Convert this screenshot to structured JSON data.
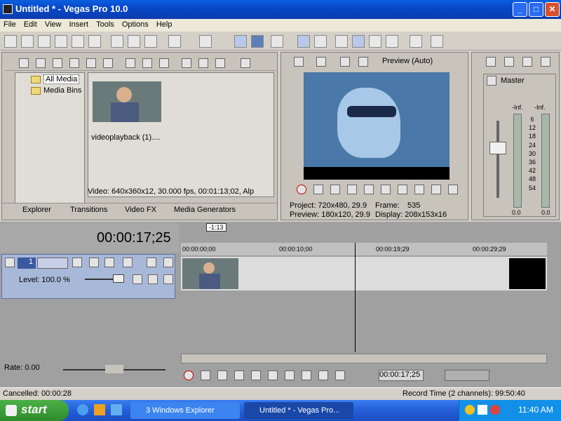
{
  "window": {
    "title": "Untitled * - Vegas Pro 10.0",
    "buttons": [
      "_",
      "□",
      "✕"
    ]
  },
  "menu": [
    "File",
    "Edit",
    "View",
    "Insert",
    "Tools",
    "Options",
    "Help"
  ],
  "explorer": {
    "tree": [
      "All Media",
      "Media Bins"
    ],
    "media_item": "videoplayback (1)....",
    "info": "Video: 640x360x12, 30.000 fps, 00:01:13;02, Alp",
    "tabs": [
      "Explorer",
      "Transitions",
      "Video FX",
      "Media Generators"
    ]
  },
  "preview": {
    "mode": "Preview (Auto)",
    "project": "Project:  720x480, 29.9",
    "preview_line": "Preview: 180x120, 29.9",
    "frame_label": "Frame:",
    "frame_value": "535",
    "display": "Display:  208x153x16"
  },
  "mixer": {
    "title": "Master",
    "inf_left": "-Inf.",
    "inf_right": "-Inf.",
    "scale": [
      "6",
      "12",
      "18",
      "24",
      "30",
      "36",
      "42",
      "48",
      "54"
    ],
    "bottom_left": "0.0",
    "bottom_right": "0.0"
  },
  "timeline": {
    "timecode": "00:00:17;25",
    "marker": "-1:13",
    "ruler": [
      "00:00:00;00",
      "00:00:10;00",
      "00:00:19;29",
      "00:00:29;29"
    ],
    "track_number": "1",
    "level": "Level: 100.0 %",
    "rate": "Rate: 0.00",
    "transport_time": "00:00:17;25"
  },
  "status": {
    "left": "Cancelled: 00:00:28",
    "right": "Record Time (2 channels): 99:50:40"
  },
  "taskbar": {
    "start": "start",
    "tasks": [
      "3 Windows Explorer",
      "Untitled * - Vegas Pro..."
    ],
    "clock": "11:40 AM"
  }
}
